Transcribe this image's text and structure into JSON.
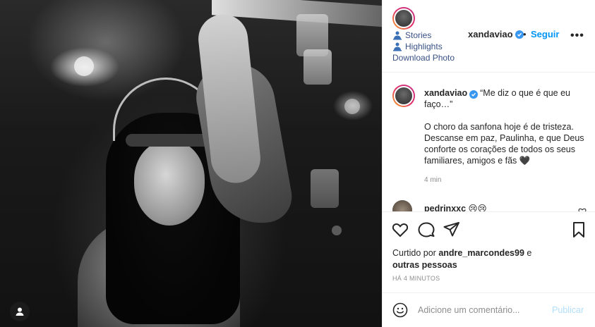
{
  "header": {
    "username": "xandaviao",
    "separator": "•",
    "follow_label": "Seguir",
    "more_label": "•••",
    "ext_links": [
      {
        "label": "Stories",
        "icon": "person-upload-icon"
      },
      {
        "label": "Highlights",
        "icon": "person-upload-icon"
      },
      {
        "label": "Download Photo",
        "icon": ""
      }
    ]
  },
  "caption": {
    "username": "xandaviao",
    "title": "“Me diz o que é que eu faço…”",
    "body": "O choro da sanfona hoje é de tristeza. Descanse em paz, Paulinha, e que Deus conforte os corações de todos os seus familiares, amigos e fãs 🖤",
    "time": "4 min"
  },
  "comment2": {
    "username": "pedrinxxc",
    "text": "😢😢"
  },
  "likes": {
    "prefix": "Curtido por",
    "user": "andre_marcondes99",
    "connector": "e",
    "others": "outras pessoas"
  },
  "time_ago": "HÁ 4 MINUTOS",
  "comment_box": {
    "placeholder": "Adicione um comentário...",
    "post_label": "Publicar"
  },
  "colors": {
    "link": "#385185",
    "follow": "#0095f6",
    "verified": "#3897f0",
    "post_disabled": "#b2dffc",
    "muted": "#8e8e8e"
  }
}
